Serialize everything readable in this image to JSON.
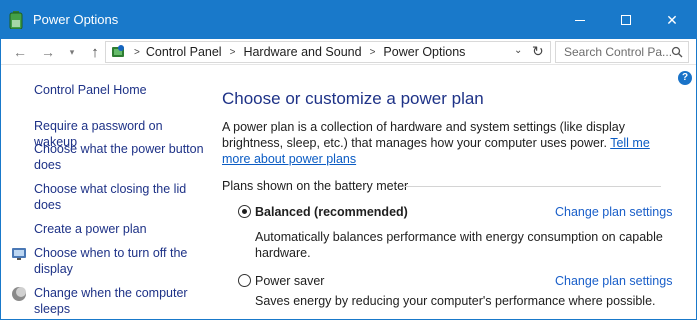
{
  "window": {
    "title": "Power Options",
    "controls": {
      "minimize": "minimize",
      "maximize": "maximize",
      "close": "✕"
    }
  },
  "nav": {
    "back": "←",
    "forward": "→",
    "up": "↑",
    "breadcrumbs": [
      "Control Panel",
      "Hardware and Sound",
      "Power Options"
    ],
    "search_placeholder": "Search Control Pa..."
  },
  "help": {
    "label": "?"
  },
  "sidebar": {
    "home": "Control Panel Home",
    "links": [
      {
        "label": "Require a password on wakeup",
        "icon": ""
      },
      {
        "label": "Choose what the power button does",
        "icon": ""
      },
      {
        "label": "Choose what closing the lid does",
        "icon": ""
      },
      {
        "label": "Create a power plan",
        "icon": ""
      },
      {
        "label": "Choose when to turn off the display",
        "icon": "display-icon"
      },
      {
        "label": "Change when the computer sleeps",
        "icon": "sleep-icon"
      }
    ]
  },
  "main": {
    "heading": "Choose or customize a power plan",
    "intro": "A power plan is a collection of hardware and system settings (like display brightness, sleep, etc.) that manages how your computer uses power.",
    "intro_link": "Tell me more about power plans",
    "section_label": "Plans shown on the battery meter",
    "plans": [
      {
        "name": "Balanced (recommended)",
        "selected": true,
        "description": "Automatically balances performance with energy consumption on capable hardware.",
        "link": "Change plan settings"
      },
      {
        "name": "Power saver",
        "selected": false,
        "description": "Saves energy by reducing your computer's performance where possible.",
        "link": "Change plan settings"
      }
    ]
  },
  "colors": {
    "titlebar": "#1979ca",
    "link": "#1e3287",
    "accent_link": "#1a5fc9"
  }
}
